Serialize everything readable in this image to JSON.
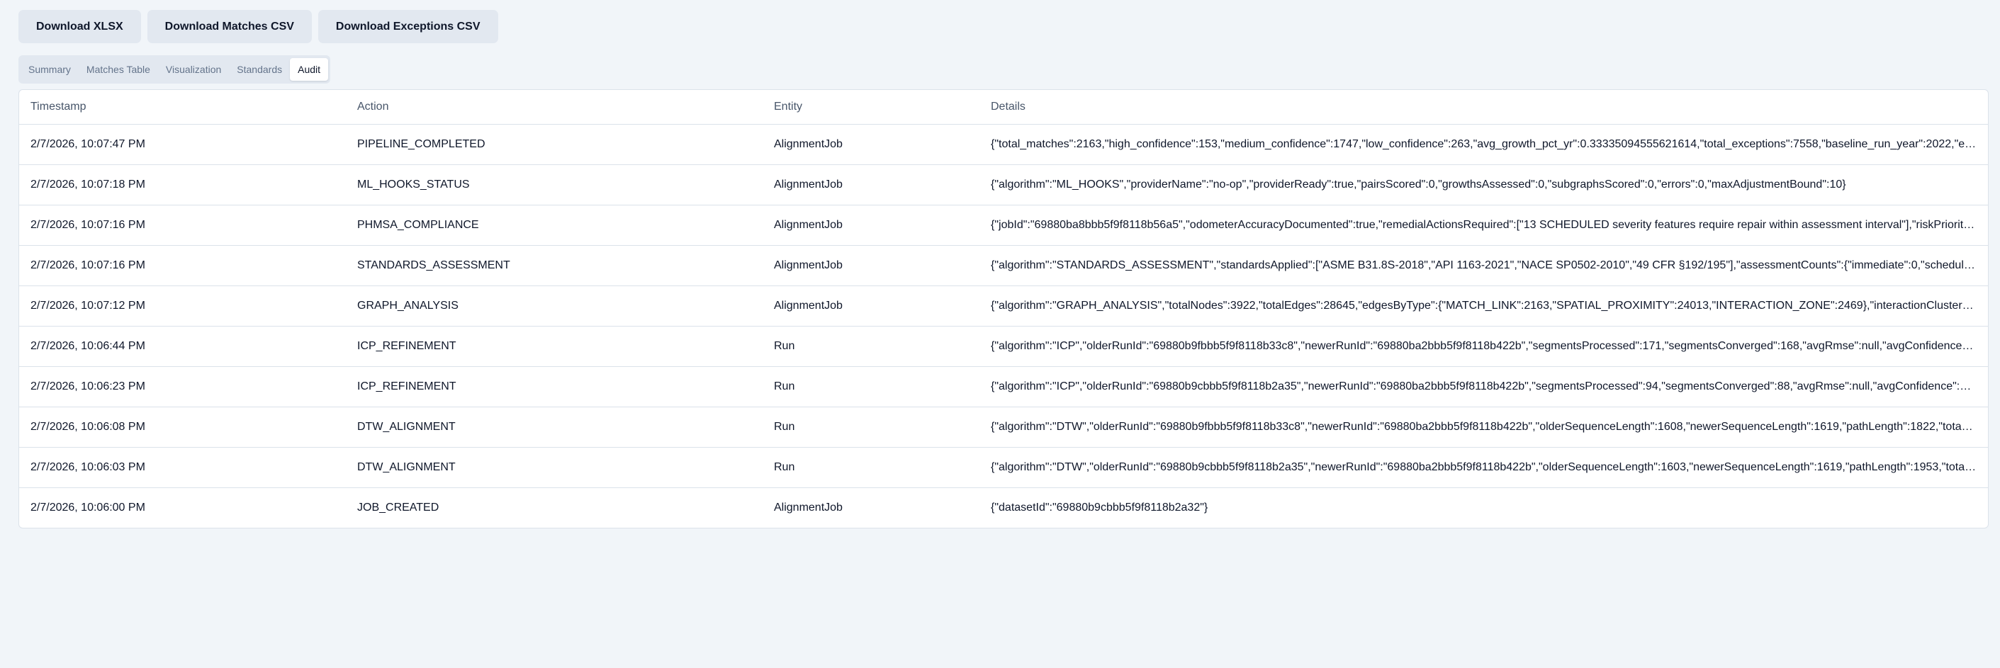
{
  "toolbar": {
    "buttons": [
      {
        "label": "Download XLSX"
      },
      {
        "label": "Download Matches CSV"
      },
      {
        "label": "Download Exceptions CSV"
      }
    ]
  },
  "tabs": [
    {
      "label": "Summary",
      "active": false
    },
    {
      "label": "Matches Table",
      "active": false
    },
    {
      "label": "Visualization",
      "active": false
    },
    {
      "label": "Standards",
      "active": false
    },
    {
      "label": "Audit",
      "active": true
    }
  ],
  "audit": {
    "columns": [
      "Timestamp",
      "Action",
      "Entity",
      "Details"
    ],
    "rows": [
      {
        "timestamp": "2/7/2026, 10:07:47 PM",
        "action": "PIPELINE_COMPLETED",
        "entity": "AlignmentJob",
        "details": "{\"total_matches\":2163,\"high_confidence\":153,\"medium_confidence\":1747,\"low_confidence\":263,\"avg_growth_pct_yr\":0.33335094555621614,\"total_exceptions\":7558,\"baseline_run_year\":2022,\"e…"
      },
      {
        "timestamp": "2/7/2026, 10:07:18 PM",
        "action": "ML_HOOKS_STATUS",
        "entity": "AlignmentJob",
        "details": "{\"algorithm\":\"ML_HOOKS\",\"providerName\":\"no-op\",\"providerReady\":true,\"pairsScored\":0,\"growthsAssessed\":0,\"subgraphsScored\":0,\"errors\":0,\"maxAdjustmentBound\":10}"
      },
      {
        "timestamp": "2/7/2026, 10:07:16 PM",
        "action": "PHMSA_COMPLIANCE",
        "entity": "AlignmentJob",
        "details": "{\"jobId\":\"69880ba8bbb5f9f8118b56a5\",\"odometerAccuracyDocumented\":true,\"remedialActionsRequired\":[\"13 SCHEDULED severity features require repair within assessment interval\"],\"riskPrioriti…"
      },
      {
        "timestamp": "2/7/2026, 10:07:16 PM",
        "action": "STANDARDS_ASSESSMENT",
        "entity": "AlignmentJob",
        "details": "{\"algorithm\":\"STANDARDS_ASSESSMENT\",\"standardsApplied\":[\"ASME B31.8S-2018\",\"API 1163-2021\",\"NACE SP0502-2010\",\"49 CFR §192/195\"],\"assessmentCounts\":{\"immediate\":0,\"schedul…"
      },
      {
        "timestamp": "2/7/2026, 10:07:12 PM",
        "action": "GRAPH_ANALYSIS",
        "entity": "AlignmentJob",
        "details": "{\"algorithm\":\"GRAPH_ANALYSIS\",\"totalNodes\":3922,\"totalEdges\":28645,\"edgesByType\":{\"MATCH_LINK\":2163,\"SPATIAL_PROXIMITY\":24013,\"INTERACTION_ZONE\":2469},\"interactionCluster…"
      },
      {
        "timestamp": "2/7/2026, 10:06:44 PM",
        "action": "ICP_REFINEMENT",
        "entity": "Run",
        "details": "{\"algorithm\":\"ICP\",\"olderRunId\":\"69880b9fbbb5f9f8118b33c8\",\"newerRunId\":\"69880ba2bbb5f9f8118b422b\",\"segmentsProcessed\":171,\"segmentsConverged\":168,\"avgRmse\":null,\"avgConfidence…"
      },
      {
        "timestamp": "2/7/2026, 10:06:23 PM",
        "action": "ICP_REFINEMENT",
        "entity": "Run",
        "details": "{\"algorithm\":\"ICP\",\"olderRunId\":\"69880b9cbbb5f9f8118b2a35\",\"newerRunId\":\"69880ba2bbb5f9f8118b422b\",\"segmentsProcessed\":94,\"segmentsConverged\":88,\"avgRmse\":null,\"avgConfidence\":…"
      },
      {
        "timestamp": "2/7/2026, 10:06:08 PM",
        "action": "DTW_ALIGNMENT",
        "entity": "Run",
        "details": "{\"algorithm\":\"DTW\",\"olderRunId\":\"69880b9fbbb5f9f8118b33c8\",\"newerRunId\":\"69880ba2bbb5f9f8118b422b\",\"olderSequenceLength\":1608,\"newerSequenceLength\":1619,\"pathLength\":1822,\"tota…"
      },
      {
        "timestamp": "2/7/2026, 10:06:03 PM",
        "action": "DTW_ALIGNMENT",
        "entity": "Run",
        "details": "{\"algorithm\":\"DTW\",\"olderRunId\":\"69880b9cbbb5f9f8118b2a35\",\"newerRunId\":\"69880ba2bbb5f9f8118b422b\",\"olderSequenceLength\":1603,\"newerSequenceLength\":1619,\"pathLength\":1953,\"tota…"
      },
      {
        "timestamp": "2/7/2026, 10:06:00 PM",
        "action": "JOB_CREATED",
        "entity": "AlignmentJob",
        "details": "{\"datasetId\":\"69880b9cbbb5f9f8118b2a32\"}"
      }
    ]
  }
}
